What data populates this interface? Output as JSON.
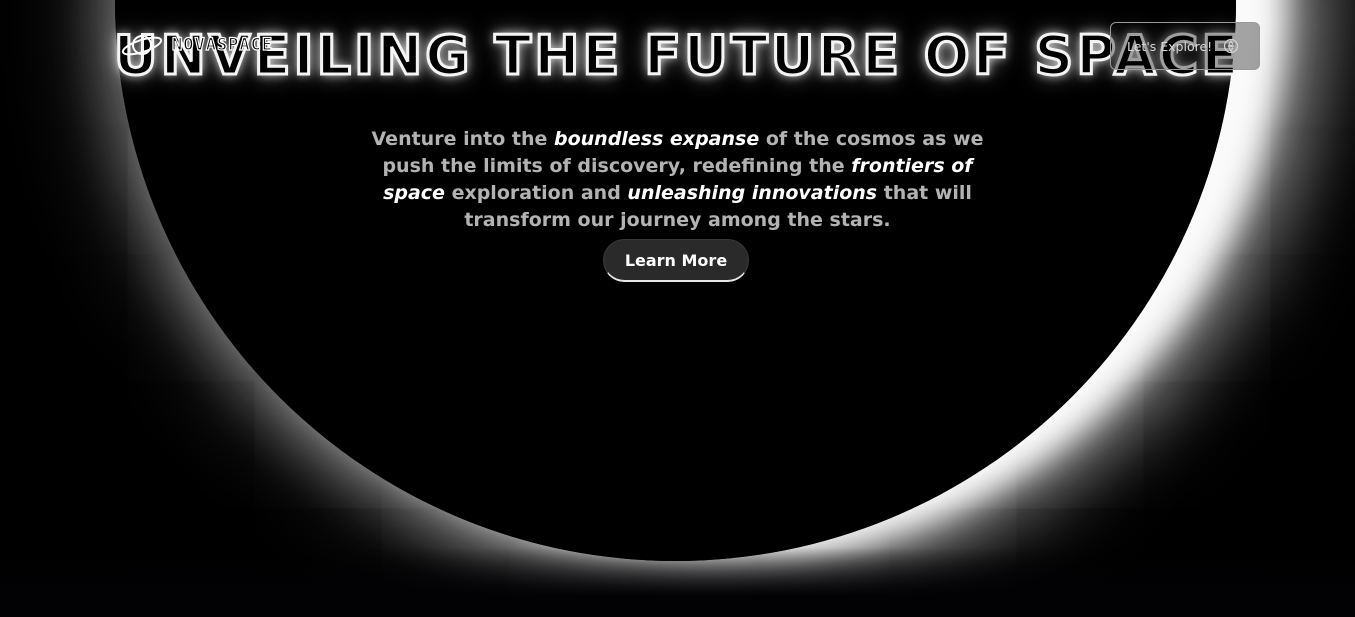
{
  "brand": {
    "name": "NOVASPACE",
    "logo_icon": "planet-ring-icon"
  },
  "navbar": {
    "explore_label": "Let's Explore!",
    "explore_icon": "rocket-icon"
  },
  "hero": {
    "title": "UNVEILING THE FUTURE OF SPACE",
    "description": {
      "part1": "Venture into the ",
      "em1": "boundless expanse",
      "part2": " of the cosmos as we push the limits of discovery, redefining the ",
      "em2": "frontiers of space",
      "part3": " exploration and ",
      "em3": "unleashing innovations",
      "part4": " that will transform our journey among the stars."
    },
    "cta_label": "Learn More"
  },
  "colors": {
    "background": "#000000",
    "glow": "#ffffff",
    "muted_text": "#b3b3b3",
    "button_bg": "#2a2a2a"
  }
}
